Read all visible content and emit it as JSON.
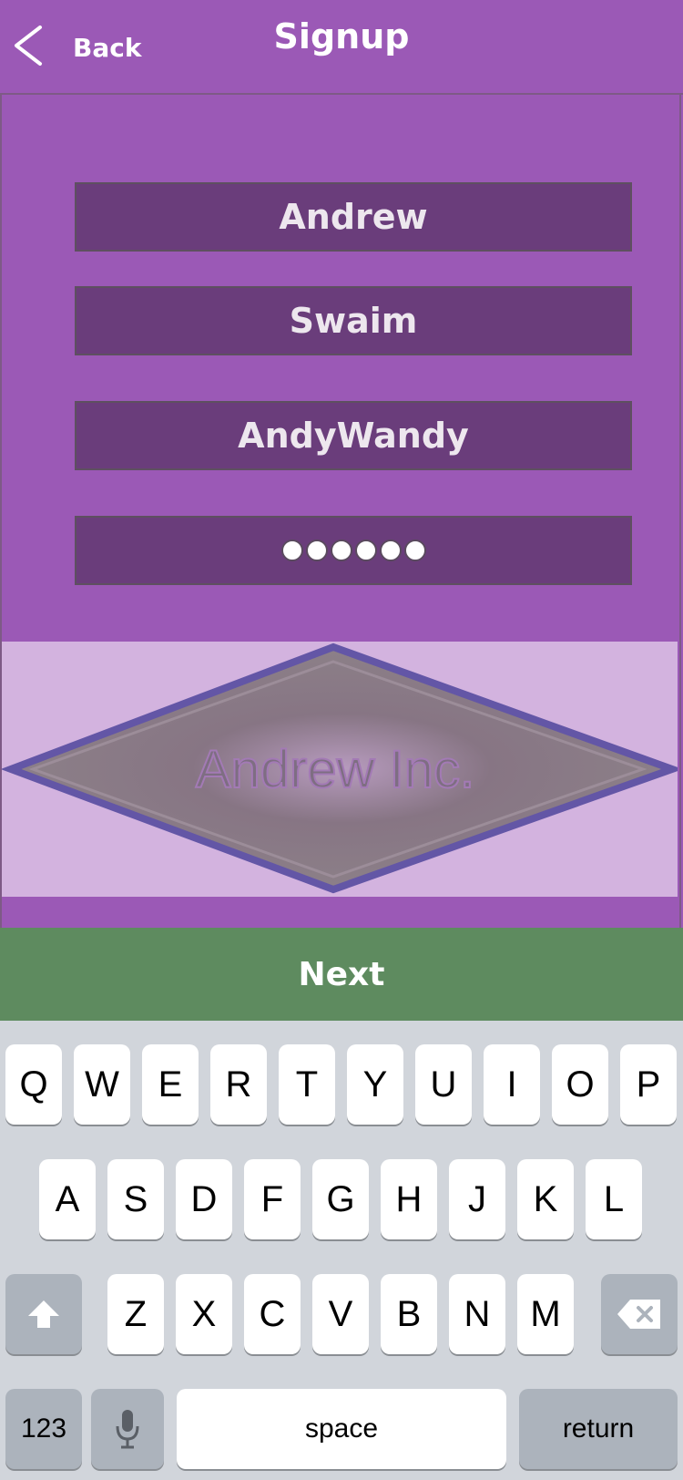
{
  "header": {
    "back_label": "Back",
    "title": "Signup"
  },
  "form": {
    "first_name": "Andrew",
    "last_name": "Swaim",
    "username": "AndyWandy",
    "password_dot_count": 6
  },
  "logo": {
    "text": "Andrew Inc."
  },
  "next_label": "Next",
  "keyboard": {
    "row1": [
      "Q",
      "W",
      "E",
      "R",
      "T",
      "Y",
      "U",
      "I",
      "O",
      "P"
    ],
    "row2": [
      "A",
      "S",
      "D",
      "F",
      "G",
      "H",
      "J",
      "K",
      "L"
    ],
    "row3": [
      "Z",
      "X",
      "C",
      "V",
      "B",
      "N",
      "M"
    ],
    "numbers_label": "123",
    "space_label": "space",
    "return_label": "return"
  },
  "colors": {
    "background": "#9B59B6",
    "field": "#6A3D7B",
    "next_button": "#5E8B5F",
    "logo_panel": "#D3B3DF",
    "keyboard": "#D1D5DB"
  }
}
